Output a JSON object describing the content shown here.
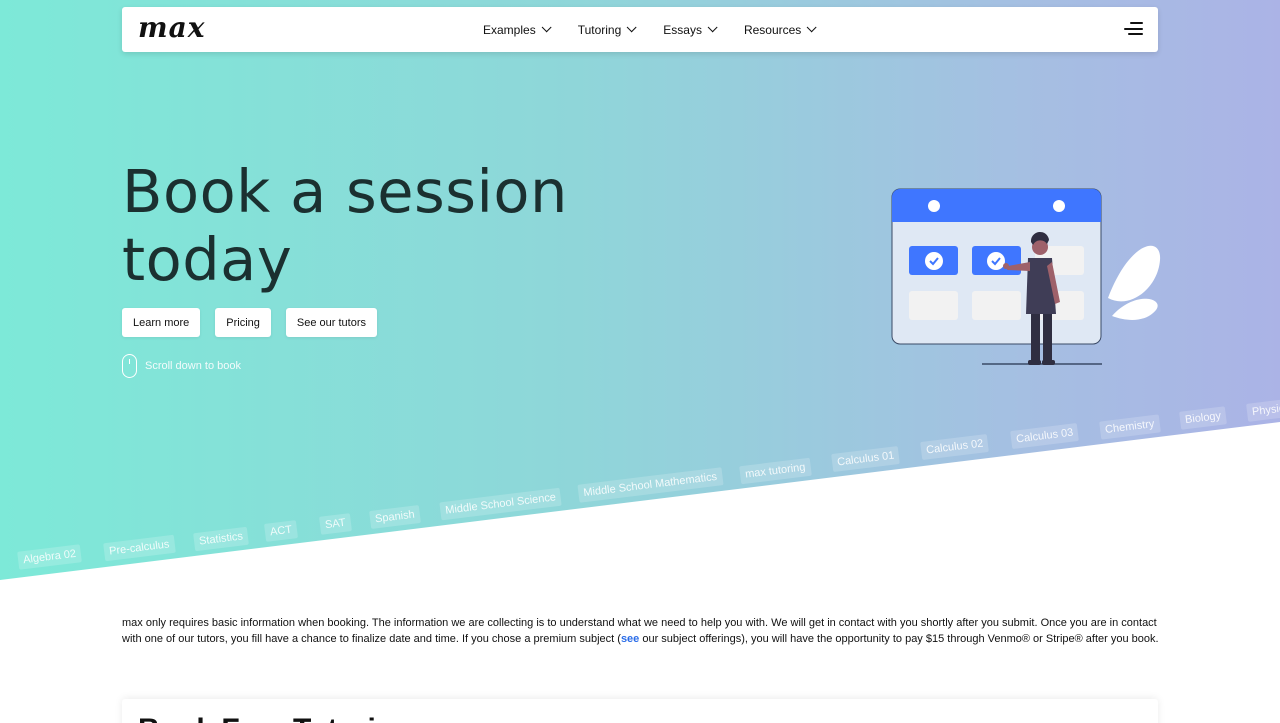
{
  "header": {
    "logo": "max",
    "nav": [
      {
        "label": "Examples"
      },
      {
        "label": "Tutoring"
      },
      {
        "label": "Essays"
      },
      {
        "label": "Resources"
      }
    ]
  },
  "hero": {
    "headline": "Book a session today",
    "buttons": {
      "learn_more": "Learn more",
      "pricing": "Pricing",
      "see_tutors": "See our tutors"
    },
    "scroll_hint": "Scroll down to book",
    "subjects": [
      "Algebra 02",
      "Pre-calculus",
      "Statistics",
      "ACT",
      "SAT",
      "Spanish",
      "Middle School Science",
      "Middle School Mathematics",
      "max tutoring",
      "Calculus 01",
      "Calculus 02",
      "Calculus 03",
      "Chemistry",
      "Biology",
      "Physics"
    ]
  },
  "info": {
    "text_before_link": "max only requires basic information when booking. The information we are collecting is to understand what we need to help you with. We will get in contact with you shortly after you submit. Once you are in contact with one of our tutors, you fill have a chance to finalize date and time. If you chose a premium subject (",
    "link": "see",
    "text_after_link": " our subject offerings), you will have the opportunity to pay $15 through Venmo® or Stripe® after you book."
  },
  "booking_card": {
    "title": "Book Free Tutoring"
  },
  "colors": {
    "hero_gradient_start": "#7de9d8",
    "hero_gradient_end": "#abb3e6",
    "accent_blue": "#3f76ff",
    "headline": "#1b3030",
    "link": "#2b6de8"
  }
}
